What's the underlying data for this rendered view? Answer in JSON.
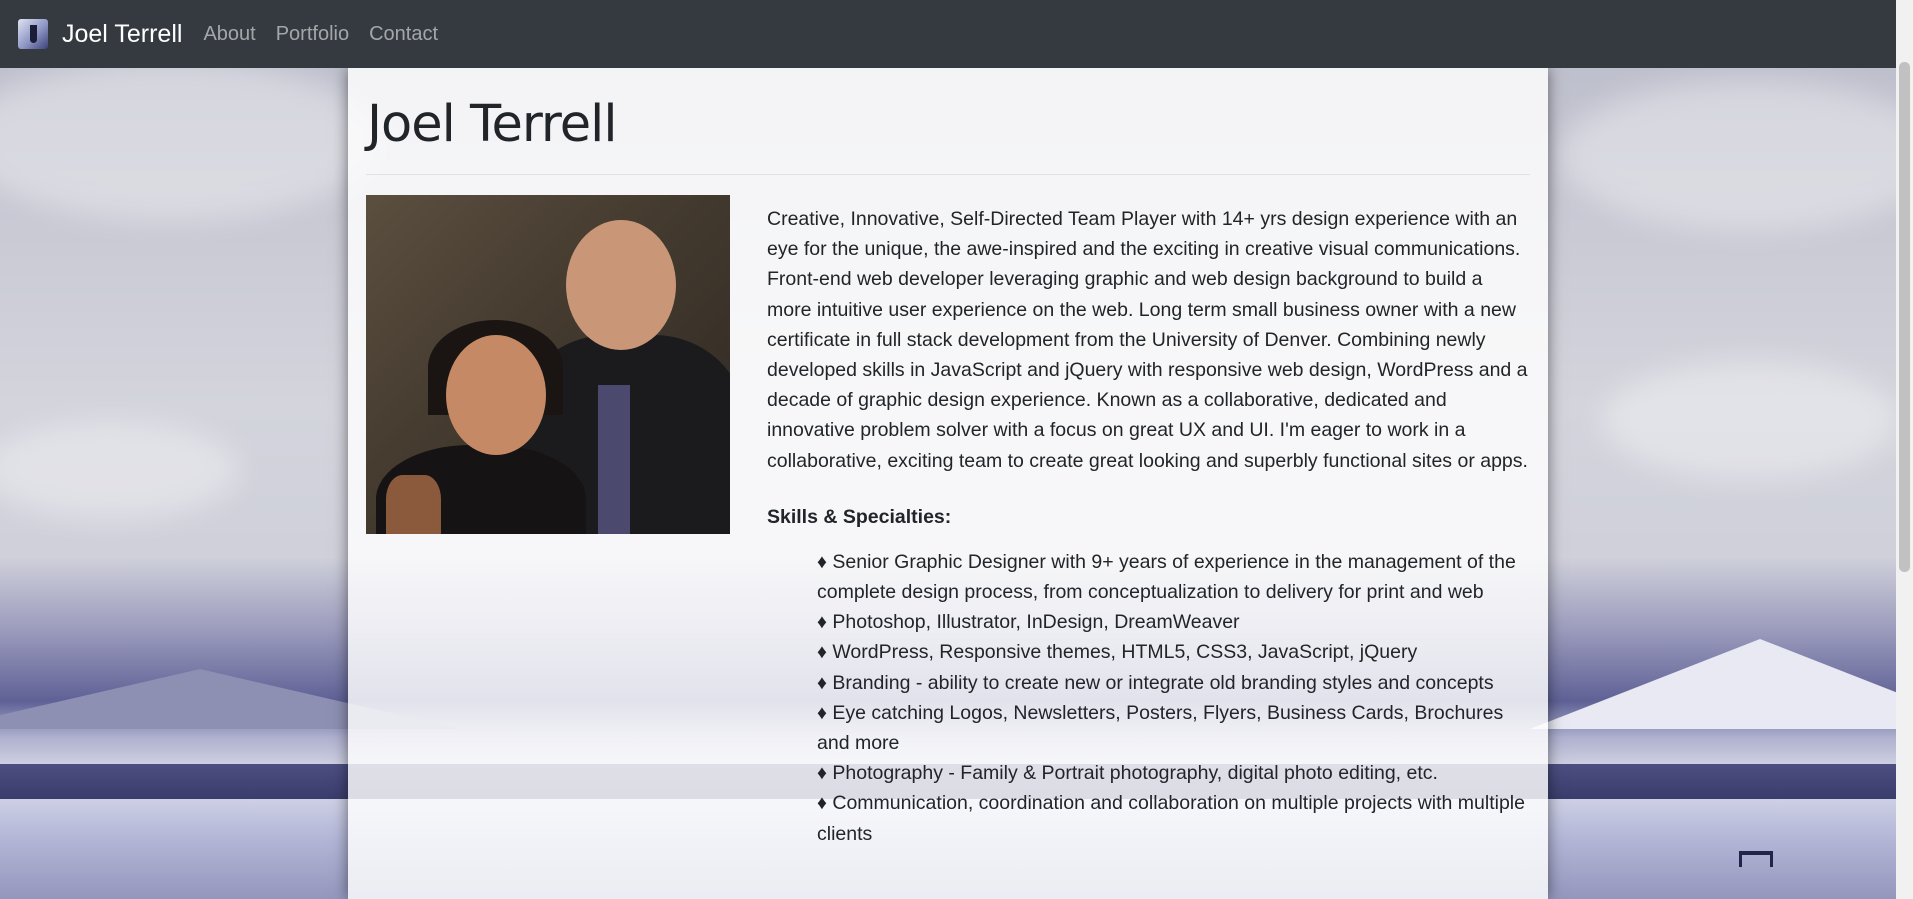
{
  "navbar": {
    "brand": "Joel Terrell",
    "links": [
      "About",
      "Portfolio",
      "Contact"
    ]
  },
  "page": {
    "title": "Joel Terrell",
    "bio": "Creative, Innovative, Self-Directed Team Player with 14+ yrs design experience with an eye for the unique, the awe-inspired and the exciting in creative visual communications. Front-end web developer leveraging graphic and web design background to build a more intuitive user experience on the web. Long term small business owner with a new certificate in full stack development from the University of Denver. Combining newly developed skills in JavaScript and jQuery with responsive web design, WordPress and a decade of graphic design experience. Known as a collaborative, dedicated and innovative problem solver with a focus on great UX and UI. I'm eager to work in a collaborative, exciting team to create great looking and superbly functional sites or apps.",
    "skills_heading": "Skills & Specialties:",
    "skills": [
      "♦ Senior Graphic Designer with 9+ years of experience in the management of the complete design process, from conceptualization to delivery for print and web",
      "♦ Photoshop, Illustrator, InDesign, DreamWeaver",
      "♦ WordPress, Responsive themes, HTML5, CSS3, JavaScript, jQuery",
      "♦ Branding - ability to create new or integrate old branding styles and concepts",
      "♦ Eye catching Logos, Newsletters, Posters, Flyers, Business Cards, Brochures and more",
      "♦ Photography - Family & Portrait photography, digital photo editing, etc.",
      "♦ Communication, coordination and collaboration on multiple projects with multiple clients"
    ]
  },
  "colors": {
    "navbar_bg": "#343a40",
    "nav_link": "rgba(255,255,255,0.55)",
    "text": "#212529"
  },
  "icons": {
    "brand_logo": "brand-logo-icon"
  }
}
